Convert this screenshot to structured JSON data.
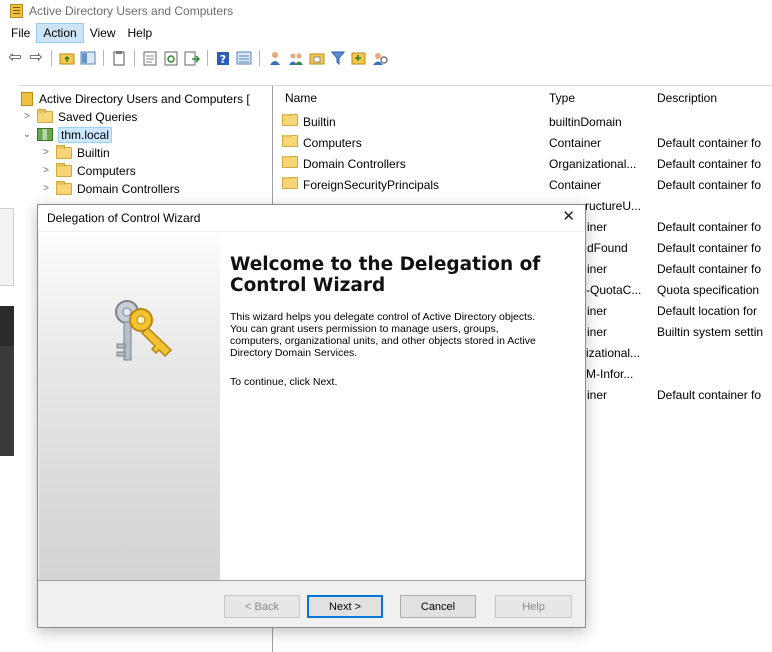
{
  "window": {
    "title": "Active Directory Users and Computers"
  },
  "menu": {
    "items": [
      "File",
      "Action",
      "View",
      "Help"
    ],
    "active": "Action"
  },
  "toolbar": {
    "icons": [
      "back-arrow",
      "forward-arrow",
      "up-folder",
      "show-tree",
      "copy",
      "properties",
      "refresh",
      "export-list",
      "help",
      "show-details",
      "new-user",
      "new-group",
      "new-ou",
      "filter",
      "add-to-group",
      "delegate"
    ]
  },
  "tree": {
    "root": "Active Directory Users and Computers [",
    "items": [
      {
        "label": "Saved Queries"
      },
      {
        "label": "thm.local"
      },
      {
        "label": "Builtin"
      },
      {
        "label": "Computers"
      },
      {
        "label": "Domain Controllers"
      }
    ]
  },
  "list": {
    "columns": [
      "Name",
      "Type",
      "Description"
    ],
    "rows": [
      {
        "name": "Builtin",
        "type": "builtinDomain",
        "desc": ""
      },
      {
        "name": "Computers",
        "type": "Container",
        "desc": "Default container fo"
      },
      {
        "name": "Domain Controllers",
        "type": "Organizational...",
        "desc": "Default container fo"
      },
      {
        "name": "ForeignSecurityPrincipals",
        "type": "Container",
        "desc": "Default container fo"
      },
      {
        "name": "",
        "type": "ructureU...",
        "desc": ""
      },
      {
        "name": "",
        "type": "iner",
        "desc": "Default container fo"
      },
      {
        "name": "",
        "type": "dFound",
        "desc": "Default container fo"
      },
      {
        "name": "",
        "type": "iner",
        "desc": "Default container fo"
      },
      {
        "name": "",
        "type": "-QuotaC...",
        "desc": "Quota specification"
      },
      {
        "name": "",
        "type": "iner",
        "desc": "Default location for"
      },
      {
        "name": "",
        "type": "iner",
        "desc": "Builtin system settin"
      },
      {
        "name": "",
        "type": "izational...",
        "desc": ""
      },
      {
        "name": "",
        "type": "M-Infor...",
        "desc": ""
      },
      {
        "name": "",
        "type": "iner",
        "desc": "Default container fo"
      }
    ]
  },
  "dialog": {
    "title": "Delegation of Control Wizard",
    "heading": "Welcome to the Delegation of Control Wizard",
    "paragraph": "This wizard helps you delegate control of Active Directory objects. You can grant users permission to manage users, groups, computers, organizational units, and other objects stored in Active Directory Domain Services.",
    "paragraph2": "To continue, click Next.",
    "buttons": {
      "back": "< Back",
      "next": "Next >",
      "cancel": "Cancel",
      "help": "Help"
    }
  }
}
